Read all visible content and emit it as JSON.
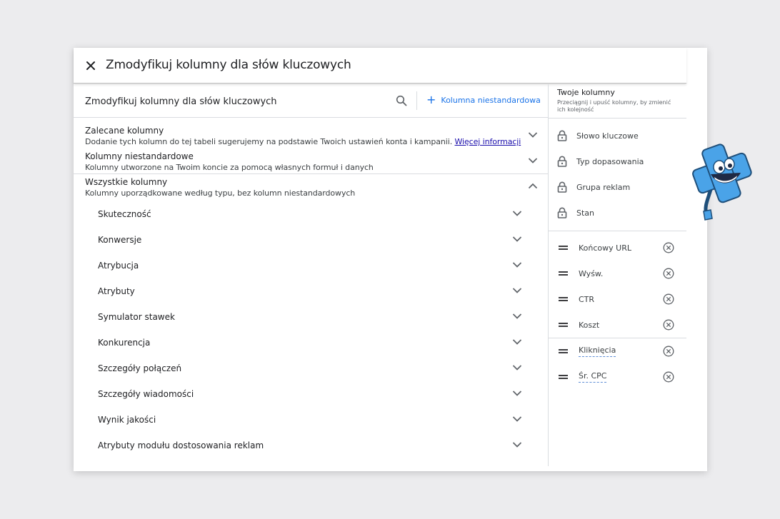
{
  "dialog": {
    "title": "Zmodyfikuj kolumny dla słów kluczowych",
    "close_icon": "close-icon"
  },
  "search": {
    "title": "Zmodyfikuj kolumny dla słów kluczowych",
    "icon": "search-icon",
    "custom_button": "Kolumna niestandardowa"
  },
  "sections": [
    {
      "title": "Zalecane kolumny",
      "desc": "Dodanie tych kolumn do tej tabeli sugerujemy na podstawie Twoich ustawień konta i kampanii.",
      "link": "Więcej informacji",
      "expanded": false
    },
    {
      "title": "Kolumny niestandardowe",
      "desc": "Kolumny utworzone na Twoim koncie za pomocą własnych formuł i danych",
      "expanded": false
    },
    {
      "title": "Wszystkie kolumny",
      "desc": "Kolumny uporządkowane według typu, bez kolumn niestandardowych",
      "expanded": true
    }
  ],
  "subsections": [
    "Skuteczność",
    "Konwersje",
    "Atrybucja",
    "Atrybuty",
    "Symulator stawek",
    "Konkurencja",
    "Szczegóły połączeń",
    "Szczegóły wiadomości",
    "Wynik jakości",
    "Atrybuty modułu dostosowania reklam"
  ],
  "your_columns": {
    "title": "Twoje kolumny",
    "hint": "Przeciągnij i upuść kolumny, by zmienić ich kolejność",
    "locked": [
      "Słowo kluczowe",
      "Typ dopasowania",
      "Grupa reklam",
      "Stan"
    ],
    "movable": [
      "Końcowy URL",
      "Wyśw.",
      "CTR",
      "Koszt"
    ],
    "movable_extra": [
      "Kliknięcia",
      "Śr. CPC"
    ]
  },
  "colors": {
    "accent": "#1a73e8",
    "link": "#1a0dab",
    "mascot": "#4aa3e8"
  }
}
